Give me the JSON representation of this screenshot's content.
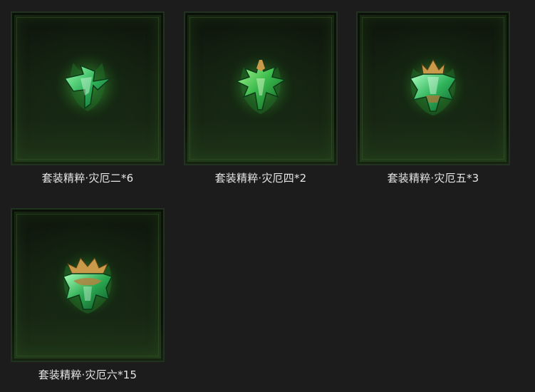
{
  "items": [
    {
      "label": "套装精粹·灾厄二*6",
      "icon": "green-cross-gem-icon"
    },
    {
      "label": "套装精粹·灾厄四*2",
      "icon": "green-winged-gem-icon"
    },
    {
      "label": "套装精粹·灾厄五*3",
      "icon": "green-crowned-gem-icon"
    },
    {
      "label": "套装精粹·灾厄六*15",
      "icon": "green-golden-crown-gem-icon"
    }
  ],
  "colors": {
    "background": "#1c1c1c",
    "label": "#e6e6e6",
    "glow": "#4bd35a",
    "gold": "#c89a4a"
  }
}
